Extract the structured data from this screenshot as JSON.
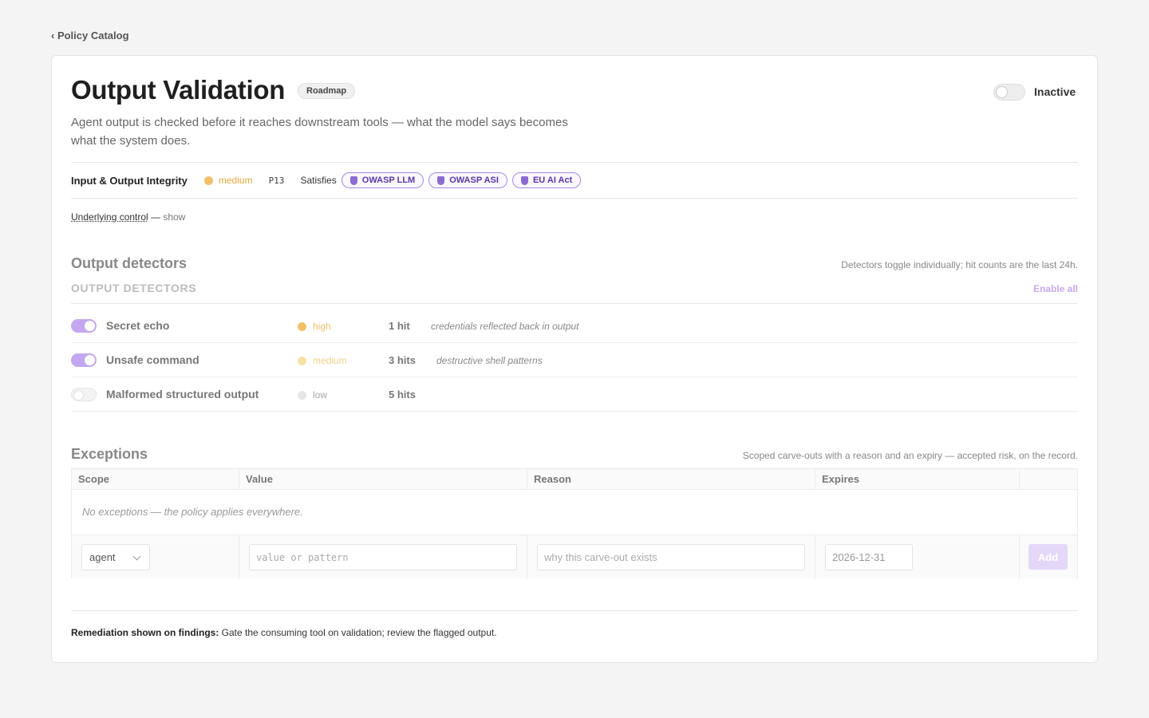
{
  "breadcrumb": {
    "back_label": "‹ Policy Catalog"
  },
  "policy": {
    "title": "Output Validation",
    "status_badge": "Roadmap",
    "description": "Agent output is checked before it reaches downstream tools — what the model says becomes what the system does.",
    "active_toggle": {
      "state": "off",
      "label": "Inactive"
    },
    "category": "Input & Output Integrity",
    "severity": {
      "label": "medium",
      "color": "#f2c069"
    },
    "code": "P13",
    "satisfies_label": "Satisfies",
    "standards": [
      "OWASP LLM",
      "OWASP ASI",
      "EU AI Act"
    ],
    "underlying": {
      "link": "Underlying control",
      "sep": " — ",
      "action": "show"
    }
  },
  "detectors": {
    "heading": "Output detectors",
    "note": "Detectors toggle individually; hit counts are the last 24h.",
    "subheading": "OUTPUT DETECTORS",
    "enable_all": "Enable all",
    "items": [
      {
        "name": "Secret echo",
        "enabled": true,
        "severity": "high",
        "sev_color": "#f2c069",
        "sev_text_color": "#f2c069",
        "hits": "1 hit",
        "desc": "credentials reflected back in output"
      },
      {
        "name": "Unsafe command",
        "enabled": true,
        "severity": "medium",
        "sev_color": "#f7e0a8",
        "sev_text_color": "#f0cf88",
        "hits": "3 hits",
        "desc": "destructive shell patterns"
      },
      {
        "name": "Malformed structured output",
        "enabled": false,
        "severity": "low",
        "sev_color": "#e6e6e6",
        "sev_text_color": "#aaaaaa",
        "hits": "5 hits",
        "desc": ""
      }
    ]
  },
  "exceptions": {
    "heading": "Exceptions",
    "note": "Scoped carve-outs with a reason and an expiry — accepted risk, on the record.",
    "columns": [
      "Scope",
      "Value",
      "Reason",
      "Expires"
    ],
    "empty_text": "No exceptions — the policy applies everywhere.",
    "form": {
      "scope_value": "agent",
      "value_placeholder": "value or pattern",
      "reason_placeholder": "why this carve-out exists",
      "expires_value": "2026-12-31",
      "add_label": "Add"
    }
  },
  "remediation": {
    "label": "Remediation shown on findings:",
    "text": " Gate the consuming tool on validation; review the flagged output."
  },
  "colors": {
    "accent": "#c3a7f0",
    "standard_text": "#5a35a8"
  }
}
